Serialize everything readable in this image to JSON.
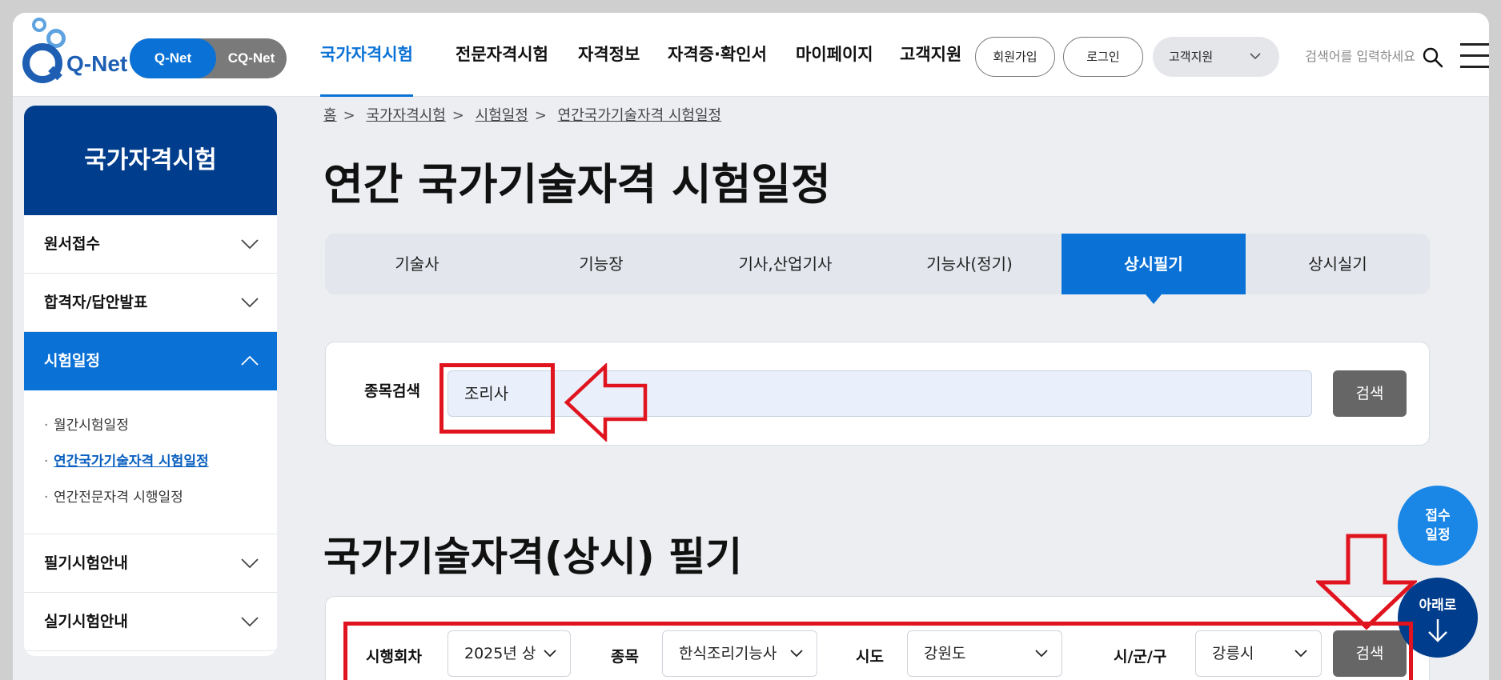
{
  "header": {
    "logo_text": "Q-Net",
    "toggle": {
      "qnet": "Q-Net",
      "cqnet": "CQ-Net"
    },
    "nav": [
      "국가자격시험",
      "전문자격시험",
      "자격정보",
      "자격증·확인서",
      "마이페이지",
      "고객지원"
    ],
    "signup": "회원가입",
    "login": "로그인",
    "support_select": "고객지원",
    "search_placeholder": "검색어를 입력하세요"
  },
  "sidebar": {
    "title": "국가자격시험",
    "items": [
      {
        "label": "원서접수"
      },
      {
        "label": "합격자/답안발표"
      },
      {
        "label": "시험일정"
      },
      {
        "label": "필기시험안내"
      },
      {
        "label": "실기시험안내"
      }
    ],
    "sub_items": [
      "월간시험일정",
      "연간국가기술자격 시험일정",
      "연간전문자격 시행일정"
    ]
  },
  "breadcrumb": [
    "홈",
    "국가자격시험",
    "시험일정",
    "연간국가기술자격 시험일정"
  ],
  "page_title": "연간 국가기술자격 시험일정",
  "tabs": [
    "기술사",
    "기능장",
    "기사,산업기사",
    "기능사(정기)",
    "상시필기",
    "상시실기"
  ],
  "search": {
    "label": "종목검색",
    "value": "조리사",
    "button": "검색"
  },
  "section_title": "국가기술자격(상시) 필기",
  "filters": {
    "round_label": "시행회차",
    "round_value": "2025년 상",
    "item_label": "종목",
    "item_value": "한식조리기능사",
    "province_label": "시도",
    "province_value": "강원도",
    "city_label": "시/군/구",
    "city_value": "강릉시",
    "button": "검색"
  },
  "floating": {
    "apply": "접수\n일정",
    "down": "아래로"
  },
  "colors": {
    "primary": "#0a72d6",
    "navy": "#003d8c",
    "annotation": "#e0141e"
  }
}
